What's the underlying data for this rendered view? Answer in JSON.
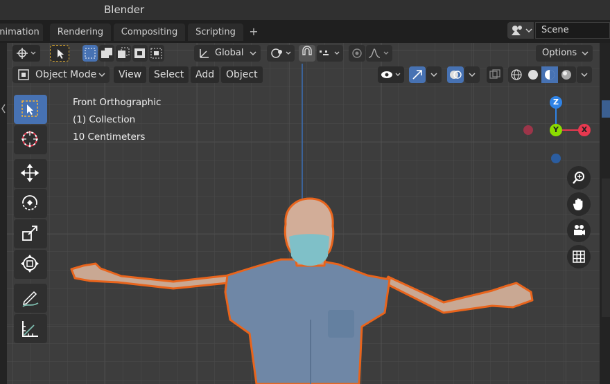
{
  "app": {
    "title": "Blender"
  },
  "workspace_tabs": [
    "nimation",
    "Rendering",
    "Compositing",
    "Scripting"
  ],
  "scene": {
    "name": "Scene"
  },
  "header": {
    "transform_orientation": "Global",
    "options_label": "Options",
    "mode_label": "Object Mode",
    "menus": [
      "View",
      "Select",
      "Add",
      "Object"
    ]
  },
  "viewport_info": {
    "view_name": "Front Orthographic",
    "collection": "(1) Collection",
    "scale": "10 Centimeters"
  },
  "gizmo": {
    "z_label": "Z",
    "y_label": "Y",
    "x_label": "X"
  },
  "colors": {
    "accent_blue": "#4772b3",
    "outline_orange": "#e8641c",
    "axis_red": "#e8384f",
    "axis_green": "#8bdc00",
    "axis_blue": "#2f83e6"
  }
}
